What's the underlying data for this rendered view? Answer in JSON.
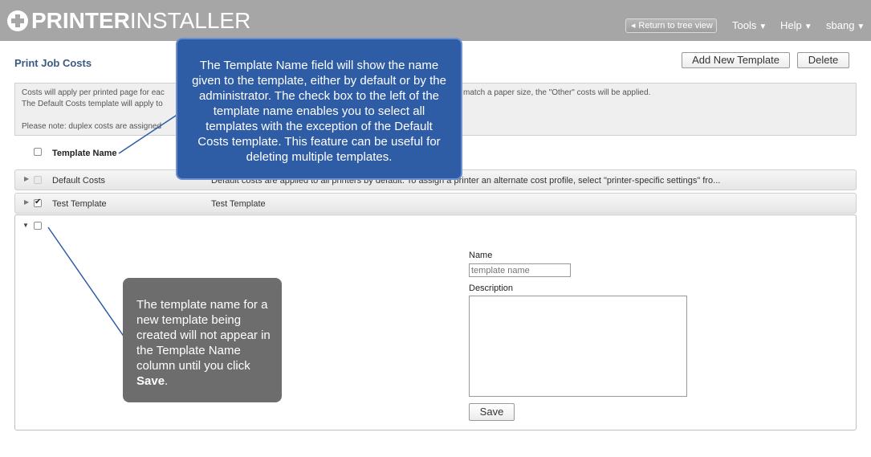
{
  "header": {
    "logo_bold": "PRINTER",
    "logo_light": "INSTALLER",
    "return_button": "Return to tree view",
    "nav": {
      "tools": "Tools",
      "help": "Help",
      "user": "sbang"
    }
  },
  "page": {
    "title": "Print Job Costs",
    "add_button": "Add New Template",
    "delete_button": "Delete"
  },
  "info": {
    "line1_left": "Costs will apply per printed page for eac",
    "line1_right": "match a paper size, the \"Other\" costs will be applied.",
    "line2": "The Default Costs template will apply to",
    "line3": "Please note: duplex costs are assigned"
  },
  "table": {
    "column_name": "Template Name",
    "rows": [
      {
        "name": "Default Costs",
        "description": "Default costs are applied to all printers by default. To assign a printer an alternate cost profile, select \"printer-specific settings\" fro...",
        "checked": false,
        "disabled": true
      },
      {
        "name": "Test Template",
        "description": "Test Template",
        "checked": true,
        "disabled": false
      }
    ]
  },
  "form": {
    "name_label": "Name",
    "name_placeholder": "template name",
    "description_label": "Description",
    "save_button": "Save"
  },
  "callouts": {
    "blue": "The Template Name field will show the name given to the template, either by default or by the administrator. The check box to the left of the template name enables you to select all templates with the exception of the Default Costs template. This feature can be useful for deleting multiple templates.",
    "grey_text": "The template name for a new template being created will not appear in the Template Name column until you click",
    "grey_bold": "Save",
    "grey_end": "."
  },
  "colors": {
    "header_bg": "#a6a6a6",
    "title_blue": "#3a5a80",
    "callout_blue": "#2e5ca5",
    "callout_grey": "#6d6d6d"
  },
  "icons": {
    "logo": "plus-circle-icon",
    "return": "left-arrow-icon",
    "caret": "caret-down-icon",
    "row_collapsed": "triangle-right-icon",
    "row_expanded": "triangle-down-icon"
  }
}
